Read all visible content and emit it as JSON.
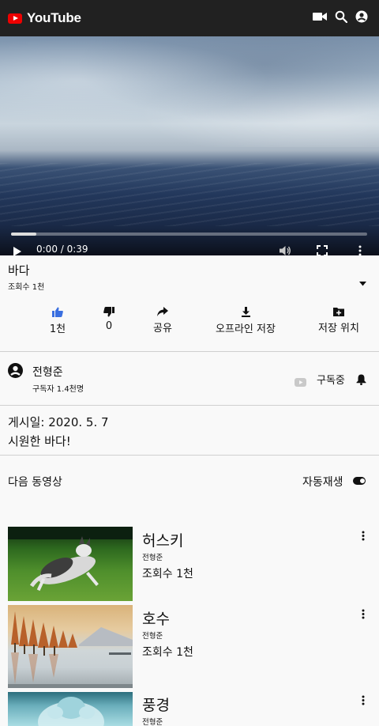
{
  "app": {
    "name": "YouTube"
  },
  "player": {
    "time": "0:00 / 0:39",
    "progress_fraction": 0.07
  },
  "video": {
    "title": "바다",
    "views": "조회수 1천"
  },
  "actions": [
    {
      "label": "1천",
      "icon": "thumbs-up-icon"
    },
    {
      "label": "0",
      "icon": "thumbs-down-icon"
    },
    {
      "label": "공유",
      "icon": "share-icon"
    },
    {
      "label": "오프라인 저장",
      "icon": "download-icon"
    },
    {
      "label": "저장 위치",
      "icon": "folder-add-icon"
    }
  ],
  "channel": {
    "name": "전형준",
    "subscribers": "구독자 1.4천명",
    "subscribed_label": "구독중"
  },
  "description": {
    "posted": "게시일: 2020. 5. 7",
    "text": "시원한 바다!"
  },
  "up_next": {
    "label": "다음 동영상",
    "autoplay_label": "자동재생",
    "autoplay_on": true
  },
  "recommendations": [
    {
      "title": "허스키",
      "channel": "전형준",
      "views": "조회수 1천"
    },
    {
      "title": "호수",
      "channel": "전형준",
      "views": "조회수 1천"
    },
    {
      "title": "풍경",
      "channel": "전형준",
      "views": ""
    }
  ],
  "colors": {
    "topbar": "#212121",
    "brand_red": "#e00000",
    "like_active": "#3a6fe0",
    "background": "#f9f9f9"
  }
}
